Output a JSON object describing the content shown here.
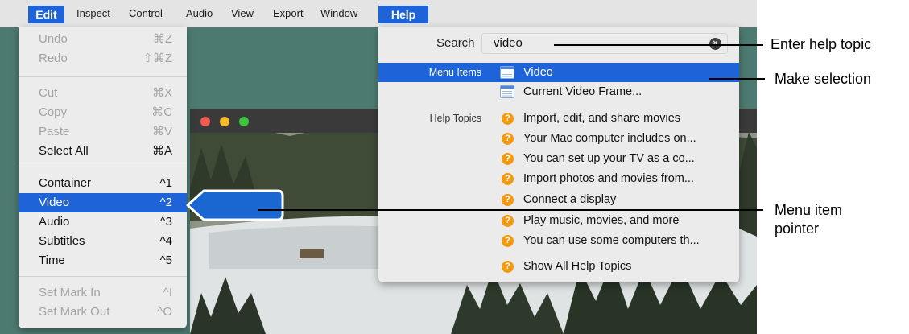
{
  "menubar": {
    "items": [
      "Edit",
      "Inspect",
      "Control",
      "Audio",
      "View",
      "Export",
      "Window",
      "Help"
    ]
  },
  "edit_menu": {
    "groups": [
      [
        {
          "label": "Undo",
          "shortcut": "⌘Z",
          "enabled": false
        },
        {
          "label": "Redo",
          "shortcut": "⇧⌘Z",
          "enabled": false
        }
      ],
      [
        {
          "label": "Cut",
          "shortcut": "⌘X",
          "enabled": false
        },
        {
          "label": "Copy",
          "shortcut": "⌘C",
          "enabled": false
        },
        {
          "label": "Paste",
          "shortcut": "⌘V",
          "enabled": false
        },
        {
          "label": "Select All",
          "shortcut": "⌘A",
          "enabled": true
        }
      ],
      [
        {
          "label": "Container",
          "shortcut": "^1",
          "enabled": true
        },
        {
          "label": "Video",
          "shortcut": "^2",
          "enabled": true,
          "selected": true
        },
        {
          "label": "Audio",
          "shortcut": "^3",
          "enabled": true
        },
        {
          "label": "Subtitles",
          "shortcut": "^4",
          "enabled": true
        },
        {
          "label": "Time",
          "shortcut": "^5",
          "enabled": true
        }
      ],
      [
        {
          "label": "Set Mark In",
          "shortcut": "^I",
          "enabled": false
        },
        {
          "label": "Set Mark Out",
          "shortcut": "^O",
          "enabled": false
        }
      ]
    ]
  },
  "help_menu": {
    "search_label": "Search",
    "search_value": "video",
    "menu_items_heading": "Menu Items",
    "menu_items": [
      "Video",
      "Current Video Frame..."
    ],
    "help_topics_heading": "Help Topics",
    "help_topics": [
      "Import, edit, and share movies",
      "Your Mac computer includes on...",
      "You can set up your TV as a co...",
      "Import photos and movies from...",
      "Connect a display",
      "Play music, movies, and more",
      "You can use some computers th..."
    ],
    "show_all": "Show All Help Topics"
  },
  "annotations": {
    "enter_topic": "Enter help topic",
    "make_selection": "Make selection",
    "menu_item_pointer": [
      "Menu item",
      "pointer"
    ]
  },
  "colors": {
    "selection": "#1f63d8",
    "help_icon": "#f29a12",
    "pointer_fill": "#1b67d2"
  }
}
